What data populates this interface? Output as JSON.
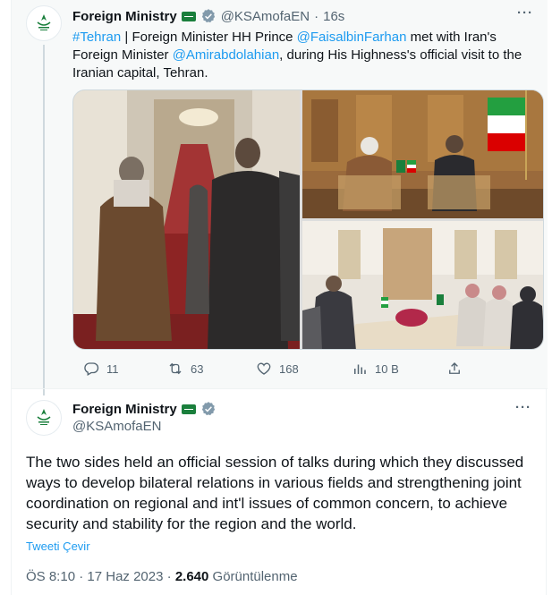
{
  "tweet1": {
    "author_name": "Foreign Ministry",
    "handle": "@KSAmofaEN",
    "separator": "·",
    "time": "16s",
    "more": "···",
    "text": {
      "hashtag": "#Tehran",
      "part1": " | Foreign Minister HH Prince ",
      "mention1": "@FaisalbinFarhan",
      "part2": " met with Iran's Foreign Minister ",
      "mention2": "@Amirabdolahian",
      "part3": ", during His Highness's official visit to the Iranian capital, Tehran."
    },
    "actions": {
      "replies": "11",
      "retweets": "63",
      "likes": "168",
      "views": "10 B"
    }
  },
  "tweet2": {
    "author_name": "Foreign Ministry",
    "handle": "@KSAmofaEN",
    "more": "···",
    "text": "The two sides held an official session of talks during which they discussed ways to develop bilateral relations in various fields and strengthening joint coordination on regional and int'l issues of common concern, to achieve security and stability for the region and the world.",
    "translate_label": "Tweeti Çevir",
    "time": "ÖS 8:10",
    "separator": " · ",
    "date": "17 Haz 2023",
    "views_count": "2.640",
    "views_label": " Görüntülenme"
  },
  "colors": {
    "link": "#1d9bf0",
    "muted": "#536471",
    "verified_badge": "#829aab",
    "affiliation_badge": "#1a7f3c"
  },
  "icons": [
    "ministry-logo-icon",
    "affiliation-flag-icon",
    "verified-badge-icon",
    "reply-icon",
    "retweet-icon",
    "like-icon",
    "views-icon",
    "share-icon"
  ]
}
